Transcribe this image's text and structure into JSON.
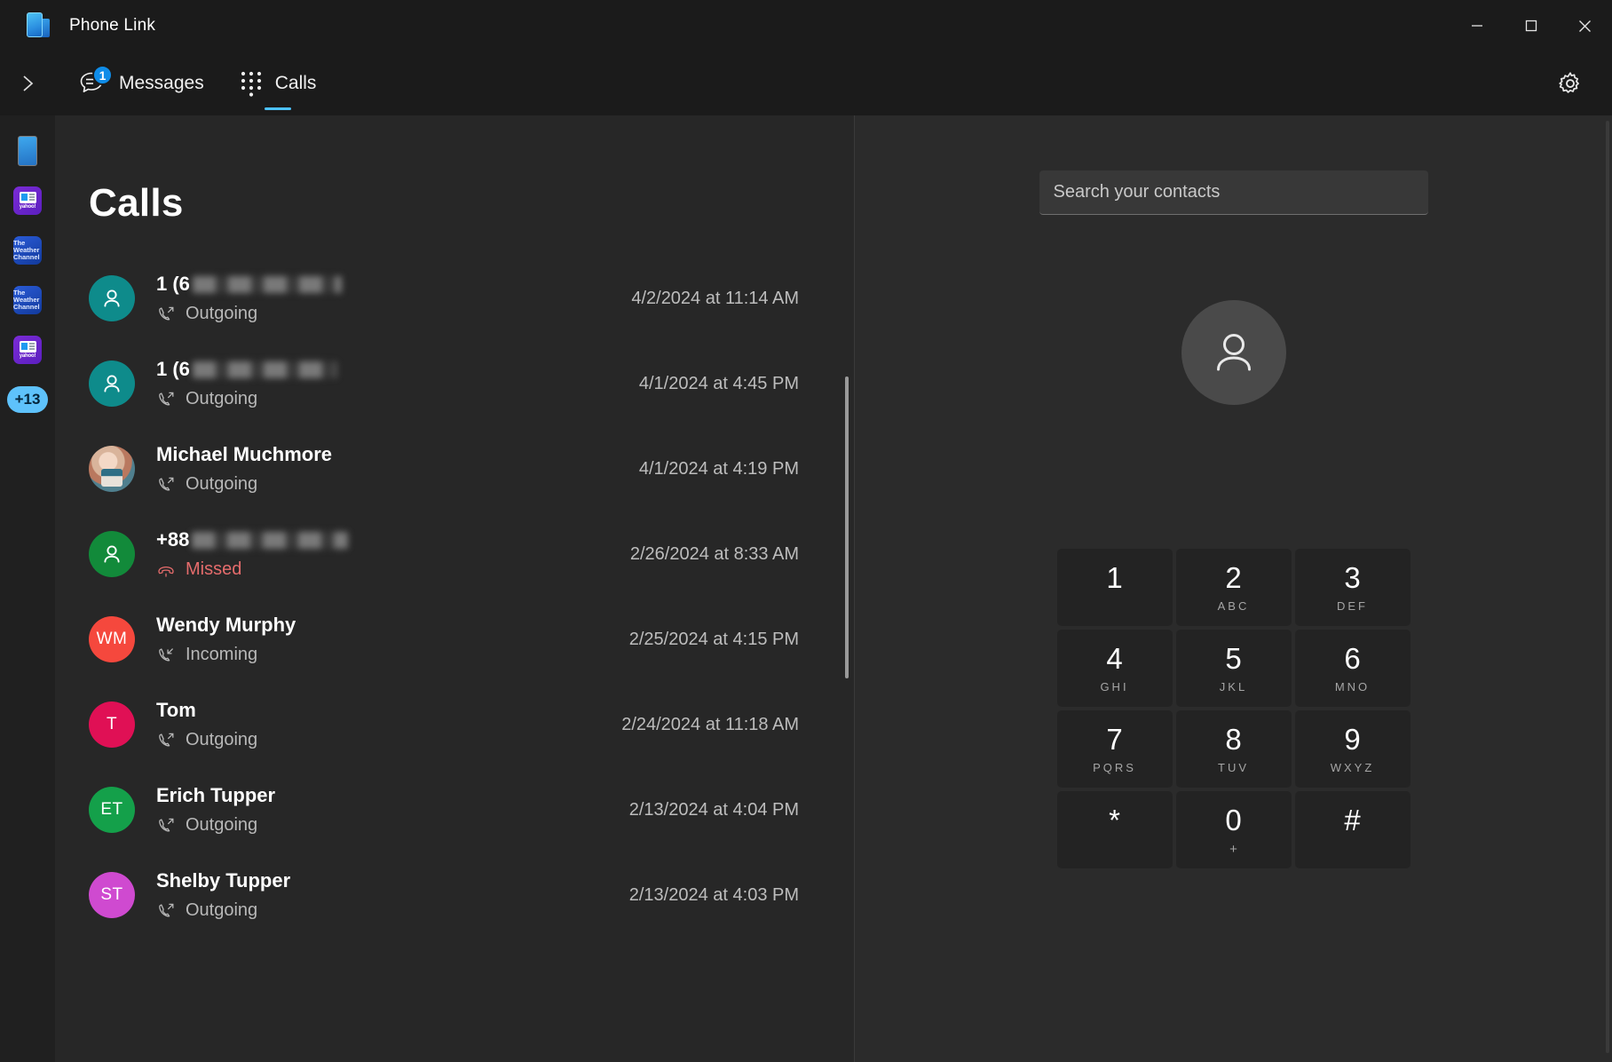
{
  "window": {
    "app_title": "Phone Link",
    "controls": {
      "minimize": "minimize-button",
      "maximize": "maximize-button",
      "close": "close-button"
    }
  },
  "tabs": [
    {
      "label": "Messages",
      "icon": "messages-icon",
      "badge": "1",
      "selected": false
    },
    {
      "label": "Calls",
      "icon": "dialpad-icon",
      "badge": "",
      "selected": true
    }
  ],
  "toolbar": {
    "expand_label": "expand-sidebar",
    "settings_label": "settings"
  },
  "rail": {
    "items": [
      {
        "name": "phone-screen",
        "type": "phone",
        "label": ""
      },
      {
        "name": "yahoo-app",
        "type": "yahoo",
        "label": "yahoo!"
      },
      {
        "name": "weather-channel-app",
        "type": "twc",
        "label": "The Weather Channel"
      },
      {
        "name": "weather-channel-app-2",
        "type": "twc",
        "label": "The Weather Channel"
      },
      {
        "name": "yahoo-app-2",
        "type": "yahoo",
        "label": "yahoo!"
      }
    ],
    "more_badge": "+13"
  },
  "calls": {
    "heading": "Calls",
    "rows": [
      {
        "name": "1 (6",
        "redacted": true,
        "redact_width": 168,
        "direction": "Outgoing",
        "missed": false,
        "time": "4/2/2024 at 11:14 AM",
        "avatar": {
          "kind": "generic",
          "color": "#0e8b8b",
          "initials": ""
        }
      },
      {
        "name": "1 (6",
        "redacted": true,
        "redact_width": 162,
        "direction": "Outgoing",
        "missed": false,
        "time": "4/1/2024 at 4:45 PM",
        "avatar": {
          "kind": "generic",
          "color": "#0e8b8b",
          "initials": ""
        }
      },
      {
        "name": "Michael Muchmore",
        "redacted": false,
        "redact_width": 0,
        "direction": "Outgoing",
        "missed": false,
        "time": "4/1/2024 at 4:19 PM",
        "avatar": {
          "kind": "photo",
          "color": "",
          "initials": ""
        }
      },
      {
        "name": "+88",
        "redacted": true,
        "redact_width": 176,
        "direction": "Missed",
        "missed": true,
        "time": "2/26/2024 at 8:33 AM",
        "avatar": {
          "kind": "generic",
          "color": "#128a3a",
          "initials": ""
        }
      },
      {
        "name": "Wendy Murphy",
        "redacted": false,
        "redact_width": 0,
        "direction": "Incoming",
        "missed": false,
        "time": "2/25/2024 at 4:15 PM",
        "avatar": {
          "kind": "initials",
          "color": "#f5483d",
          "initials": "WM"
        }
      },
      {
        "name": "Tom",
        "redacted": false,
        "redact_width": 0,
        "direction": "Outgoing",
        "missed": false,
        "time": "2/24/2024 at 11:18 AM",
        "avatar": {
          "kind": "initials",
          "color": "#e01055",
          "initials": "T"
        }
      },
      {
        "name": "Erich Tupper",
        "redacted": false,
        "redact_width": 0,
        "direction": "Outgoing",
        "missed": false,
        "time": "2/13/2024 at 4:04 PM",
        "avatar": {
          "kind": "initials",
          "color": "#14a04a",
          "initials": "ET"
        }
      },
      {
        "name": "Shelby Tupper",
        "redacted": false,
        "redact_width": 0,
        "direction": "Outgoing",
        "missed": false,
        "time": "2/13/2024 at 4:03 PM",
        "avatar": {
          "kind": "initials",
          "color": "#cf4ad0",
          "initials": "ST"
        }
      }
    ]
  },
  "dialer": {
    "search": {
      "value": "",
      "placeholder": "Search your contacts"
    },
    "contact_avatar": "person-icon",
    "keys": [
      {
        "digit": "1",
        "letters": ""
      },
      {
        "digit": "2",
        "letters": "ABC"
      },
      {
        "digit": "3",
        "letters": "DEF"
      },
      {
        "digit": "4",
        "letters": "GHI"
      },
      {
        "digit": "5",
        "letters": "JKL"
      },
      {
        "digit": "6",
        "letters": "MNO"
      },
      {
        "digit": "7",
        "letters": "PQRS"
      },
      {
        "digit": "8",
        "letters": "TUV"
      },
      {
        "digit": "9",
        "letters": "WXYZ"
      },
      {
        "digit": "*",
        "letters": ""
      },
      {
        "digit": "0",
        "letters": "+"
      },
      {
        "digit": "#",
        "letters": ""
      }
    ]
  },
  "colors": {
    "accent": "#4cc2ff",
    "badge": "#0f8ce8",
    "missed": "#e56c6c",
    "pane_left": "#272727",
    "pane_right": "#2b2b2b"
  }
}
